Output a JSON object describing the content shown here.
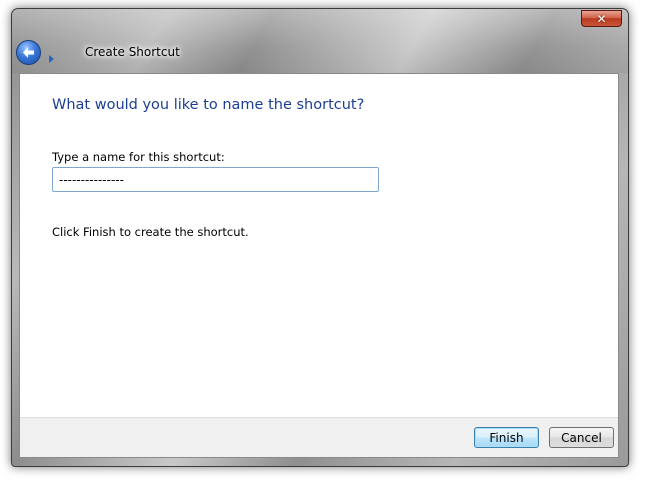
{
  "window": {
    "title": "Create Shortcut",
    "close_glyph": "✕"
  },
  "icons": {
    "back": "back-arrow-icon",
    "forward": "forward-arrow-icon",
    "close": "close-icon"
  },
  "wizard": {
    "heading": "What would you like to name the shortcut?",
    "name_label": "Type a name for this shortcut:",
    "name_value": "---------------",
    "instruction": "Click Finish to create the shortcut."
  },
  "buttons": {
    "finish_label": "Finish",
    "cancel_label": "Cancel"
  },
  "colors": {
    "heading": "#1c3f94",
    "close_button": "#c9553a",
    "back_button": "#3a78d8",
    "default_button_border": "#3c7fb1"
  }
}
